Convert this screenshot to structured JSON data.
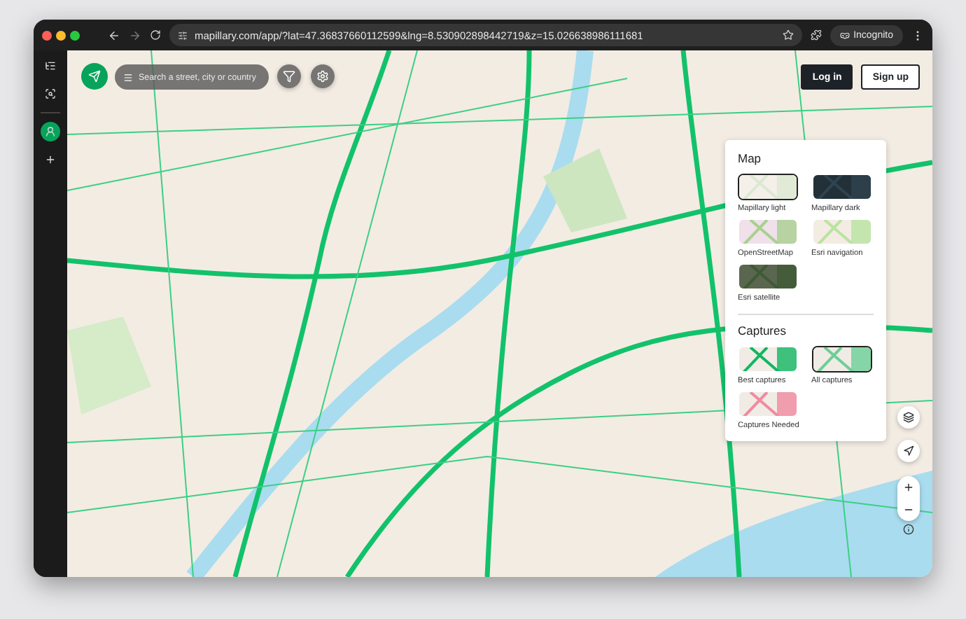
{
  "browser": {
    "url": "mapillary.com/app/?lat=47.36837660112599&lng=8.530902898442719&z=15.026638986111681",
    "profile_label": "Incognito"
  },
  "sidebar": {
    "items": [
      {
        "kind": "list",
        "selected": false
      },
      {
        "kind": "search",
        "selected": false
      },
      {
        "kind": "profile",
        "selected": true
      },
      {
        "kind": "add",
        "selected": false
      }
    ]
  },
  "search": {
    "placeholder": "Search a street, city or country"
  },
  "auth_buttons": [
    {
      "label": "Log in",
      "kind": "primary"
    },
    {
      "label": "Sign up",
      "kind": "secondary"
    }
  ],
  "layers_panel": {
    "sections": [
      {
        "title": "Map",
        "options": [
          {
            "label": "Mapillary light",
            "kind": "light",
            "selected": true
          },
          {
            "label": "Mapillary dark",
            "kind": "dark",
            "selected": false
          },
          {
            "label": "OpenStreetMap",
            "kind": "osm",
            "selected": false
          },
          {
            "label": "Esri navigation",
            "kind": "navigation",
            "selected": false
          },
          {
            "label": "Esri satellite",
            "kind": "satellite",
            "selected": false
          }
        ]
      },
      {
        "title": "Captures",
        "options": [
          {
            "label": "Best captures",
            "kind": "best",
            "selected": false
          },
          {
            "label": "All captures",
            "kind": "all",
            "selected": true
          },
          {
            "label": "Captures Needed",
            "kind": "needed",
            "selected": false
          }
        ]
      }
    ]
  }
}
